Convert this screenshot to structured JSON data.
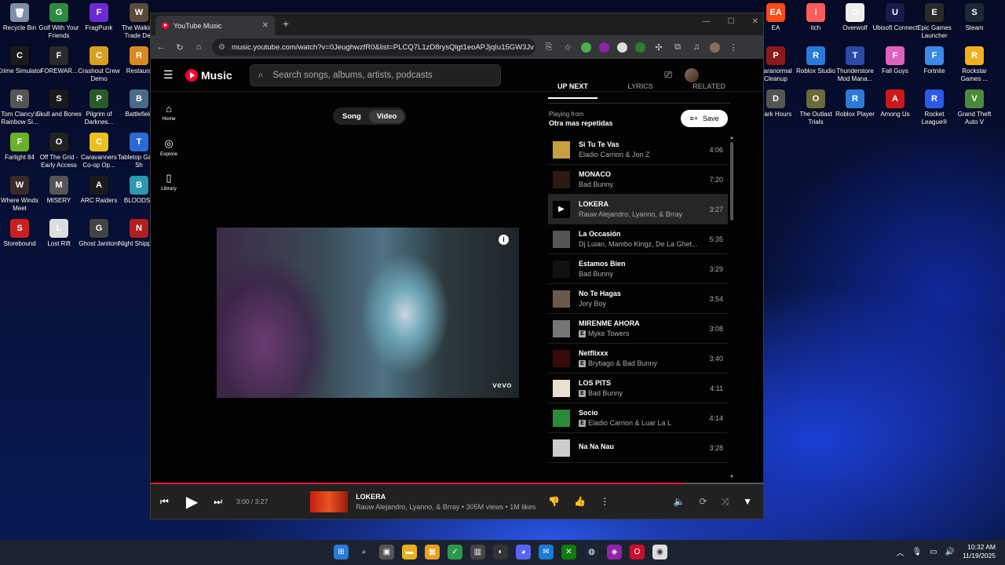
{
  "desktop": {
    "left_icons": [
      {
        "label": "Recycle Bin",
        "color": "#7a8fa8",
        "glyph": "🗑"
      },
      {
        "label": "Golf With Your Friends",
        "color": "#2e8a3e",
        "glyph": "G"
      },
      {
        "label": "FragPunk",
        "color": "#6b2bd4",
        "glyph": "F"
      },
      {
        "label": "The Walking Trade Dec",
        "color": "#5a4a3a",
        "glyph": "W"
      },
      {
        "label": "Crime Simulator",
        "color": "#1a1a1a",
        "glyph": "C"
      },
      {
        "label": "FOREWAR...",
        "color": "#2a2a2a",
        "glyph": "F"
      },
      {
        "label": "Crashout Crew Demo",
        "color": "#d8a020",
        "glyph": "C"
      },
      {
        "label": "Restaura",
        "color": "#d88a20",
        "glyph": "R"
      },
      {
        "label": "Tom Clancy's Rainbow Si...",
        "color": "#555",
        "glyph": "R"
      },
      {
        "label": "Skull and Bones",
        "color": "#1a1a1a",
        "glyph": "S"
      },
      {
        "label": "Pilgrim of Darknes...",
        "color": "#2a5a2a",
        "glyph": "P"
      },
      {
        "label": "Battlefield",
        "color": "#4a6a8a",
        "glyph": "B"
      },
      {
        "label": "Farlight 84",
        "color": "#6ab02a",
        "glyph": "F"
      },
      {
        "label": "Off The Grid - Early Access",
        "color": "#222",
        "glyph": "O"
      },
      {
        "label": "Caravanners Co-op Op...",
        "color": "#e8c020",
        "glyph": "C"
      },
      {
        "label": "Tabletop Game Sh",
        "color": "#2a6ad8",
        "glyph": "T"
      },
      {
        "label": "Where Winds Meet",
        "color": "#3a2a2a",
        "glyph": "W"
      },
      {
        "label": "MISERY",
        "color": "#555",
        "glyph": "M"
      },
      {
        "label": "ARC Raiders",
        "color": "#1a1a1a",
        "glyph": "A"
      },
      {
        "label": "BLOODST",
        "color": "#2a9ab0",
        "glyph": "B"
      },
      {
        "label": "Storebound",
        "color": "#c82020",
        "glyph": "S"
      },
      {
        "label": "Lost Rift",
        "color": "#ddd",
        "glyph": "L"
      },
      {
        "label": "Ghost Janitors",
        "color": "#444",
        "glyph": "G"
      },
      {
        "label": "Night Shippe...",
        "color": "#b02020",
        "glyph": "N"
      }
    ],
    "right_icons": [
      {
        "label": "EA",
        "color": "#ff4a1a",
        "glyph": "EA"
      },
      {
        "label": "itch",
        "color": "#fa5c5c",
        "glyph": "i"
      },
      {
        "label": "Overwolf",
        "color": "#eee",
        "glyph": "O"
      },
      {
        "label": "Ubisoft Connect",
        "color": "#1a1a4a",
        "glyph": "U"
      },
      {
        "label": "Epic Games Launcher",
        "color": "#2a2a2a",
        "glyph": "E"
      },
      {
        "label": "Steam",
        "color": "#1b2838",
        "glyph": "S"
      },
      {
        "label": "Paranormal Cleanup",
        "color": "#8a1a1a",
        "glyph": "P"
      },
      {
        "label": "Roblox Studio",
        "color": "#2a7ad8",
        "glyph": "R"
      },
      {
        "label": "Thunderstore Mod Mana...",
        "color": "#2a4aa8",
        "glyph": "T"
      },
      {
        "label": "Fall Guys",
        "color": "#e060c0",
        "glyph": "F"
      },
      {
        "label": "Fortnite",
        "color": "#3a8ae8",
        "glyph": "F"
      },
      {
        "label": "Rockstar Games ...",
        "color": "#f0b020",
        "glyph": "R"
      },
      {
        "label": "Dark Hours",
        "color": "#555",
        "glyph": "D"
      },
      {
        "label": "The Outlast Trials",
        "color": "#6a6a3a",
        "glyph": "O"
      },
      {
        "label": "Roblox Player",
        "color": "#2a7ad8",
        "glyph": "R"
      },
      {
        "label": "Among Us",
        "color": "#c81a1a",
        "glyph": "A"
      },
      {
        "label": "Rocket League®",
        "color": "#2a5ae8",
        "glyph": "R"
      },
      {
        "label": "Grand Theft Auto V",
        "color": "#4a8a3a",
        "glyph": "V"
      }
    ]
  },
  "browser": {
    "tab_title": "YouTube Music",
    "url": "music.youtube.com/watch?v=0JeughwzfR0&list=PLCQ7L1zD8rysQlgt1eoAPJjqIu15GW3Jv"
  },
  "app": {
    "logo_text": "Music",
    "search_placeholder": "Search songs, albums, artists, podcasts",
    "nav": [
      {
        "label": "Home",
        "icon": "⌂"
      },
      {
        "label": "Explore",
        "icon": "◎"
      },
      {
        "label": "Library",
        "icon": "▯"
      }
    ],
    "toggle": {
      "song": "Song",
      "video": "Video"
    },
    "video_watermark": "vevo",
    "queue_tabs": {
      "up_next": "UP NEXT",
      "lyrics": "LYRICS",
      "related": "RELATED"
    },
    "playing_from_label": "Playing from",
    "playlist_name": "Otra mas repetidas",
    "save_label": "Save",
    "queue": [
      {
        "title": "Si Tu Te Vas",
        "artist": "Eladio Carrion & Jon Z",
        "duration": "4:06",
        "explicit": false,
        "thumb": "#c8a040",
        "current": false
      },
      {
        "title": "MONACO",
        "artist": "Bad Bunny",
        "duration": "7:20",
        "explicit": false,
        "thumb": "#2a1a12",
        "current": false
      },
      {
        "title": "LOKERA",
        "artist": "Rauw Alejandro, Lyanno, & Brray",
        "duration": "3:27",
        "explicit": false,
        "thumb": "#000000",
        "current": true
      },
      {
        "title": "La Occasión",
        "artist": "Dj Luian, Mambo Kingz, De La Ghet...",
        "duration": "5:35",
        "explicit": false,
        "thumb": "#555555",
        "current": false
      },
      {
        "title": "Estamos Bien",
        "artist": "Bad Bunny",
        "duration": "3:29",
        "explicit": false,
        "thumb": "#111111",
        "current": false
      },
      {
        "title": "No Te Hagas",
        "artist": "Jory Boy",
        "duration": "3:54",
        "explicit": false,
        "thumb": "#6a5a4a",
        "current": false
      },
      {
        "title": "MIRENME AHORA",
        "artist": "Myke Towers",
        "duration": "3:08",
        "explicit": true,
        "thumb": "#777777",
        "current": false
      },
      {
        "title": "Netflixxx",
        "artist": "Brytiago & Bad Bunny",
        "duration": "3:40",
        "explicit": true,
        "thumb": "#3a0a0a",
        "current": false
      },
      {
        "title": "LOS PITS",
        "artist": "Bad Bunny",
        "duration": "4:11",
        "explicit": true,
        "thumb": "#e8e0d0",
        "current": false
      },
      {
        "title": "Socio",
        "artist": "Eladio Carrion & Luar La L",
        "duration": "4:14",
        "explicit": true,
        "thumb": "#2a8a3a",
        "current": false
      },
      {
        "title": "Na Na Nau",
        "artist": "",
        "duration": "3:28",
        "explicit": false,
        "thumb": "#cccccc",
        "current": false
      }
    ],
    "player": {
      "time": "3:00 / 3:27",
      "progress": 0.87,
      "title": "LOKERA",
      "meta": "Rauw Alejandro, Lyanno, & Brray • 305M views • 1M likes"
    }
  },
  "taskbar": {
    "time": "10:32 AM",
    "date": "11/19/2025"
  }
}
